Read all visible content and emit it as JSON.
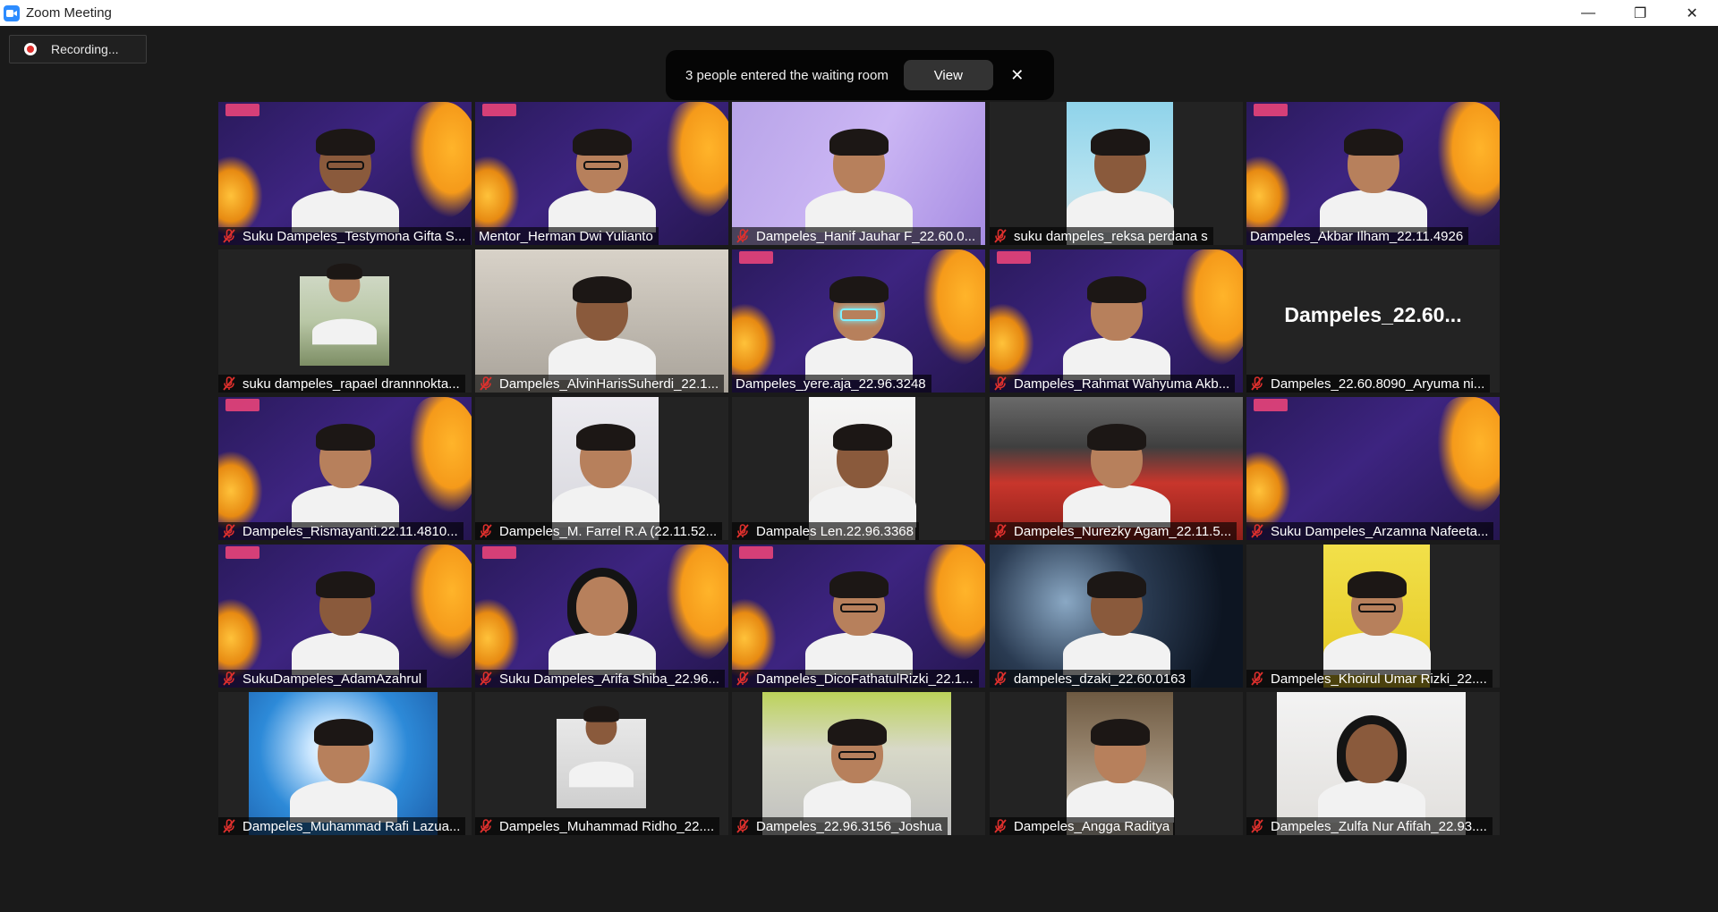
{
  "window": {
    "title": "Zoom Meeting",
    "minimize": "—",
    "restore": "❐",
    "close": "✕"
  },
  "recording": {
    "label": "Recording..."
  },
  "waiting_notice": {
    "message": "3 people entered the waiting room",
    "view_label": "View",
    "close": "✕"
  },
  "colors": {
    "active_speaker_border": "#e6e35a",
    "muted_mic": "#e0302d",
    "zoom_blue": "#2d8cff"
  },
  "participants": [
    {
      "name": "Suku Dampeles_Testymona Gifta S...",
      "muted": true,
      "active": false,
      "bg": "purple",
      "video": "full"
    },
    {
      "name": "Mentor_Herman Dwi Yulianto",
      "muted": false,
      "active": true,
      "bg": "purple",
      "video": "full"
    },
    {
      "name": "Dampeles_Hanif Jauhar F_22.60.0...",
      "muted": true,
      "active": false,
      "bg": "lilac",
      "video": "full"
    },
    {
      "name": "suku dampeles_reksa perdana s",
      "muted": true,
      "active": false,
      "bg": "sky",
      "video": "narrow"
    },
    {
      "name": "Dampeles_Akbar Ilham_22.11.4926",
      "muted": false,
      "active": false,
      "bg": "purple",
      "video": "full"
    },
    {
      "name": "suku dampeles_rapael drannnokta...",
      "muted": true,
      "active": false,
      "bg": "grass",
      "video": "small"
    },
    {
      "name": "Dampeles_AlvinHarisSuherdi_22.1...",
      "muted": true,
      "active": false,
      "bg": "room",
      "video": "full"
    },
    {
      "name": "Dampeles_yere.aja_22.96.3248",
      "muted": false,
      "active": false,
      "bg": "purple",
      "video": "full"
    },
    {
      "name": "Dampeles_Rahmat Wahyuma Akb...",
      "muted": true,
      "active": false,
      "bg": "purple",
      "video": "full"
    },
    {
      "name": "Dampeles_22.60.8090_Aryuma ni...",
      "muted": true,
      "active": false,
      "bg": "none",
      "video": "none",
      "display_name": "Dampeles_22.60..."
    },
    {
      "name": "Dampeles_Rismayanti.22.11.4810...",
      "muted": true,
      "active": false,
      "bg": "purple",
      "video": "full"
    },
    {
      "name": "Dampeles_M. Farrel R.A (22.11.52...",
      "muted": true,
      "active": false,
      "bg": "light",
      "video": "narrow"
    },
    {
      "name": "Dampales Len.22.96.3368",
      "muted": true,
      "active": false,
      "bg": "white",
      "video": "narrow"
    },
    {
      "name": "Dampeles_Nurezky Agam_22.11.5...",
      "muted": true,
      "active": false,
      "bg": "red",
      "video": "full"
    },
    {
      "name": "Suku Dampeles_Arzamna Nafeeta...",
      "muted": true,
      "active": false,
      "bg": "purple",
      "video": "full"
    },
    {
      "name": "SukuDampeles_AdamAzahrul",
      "muted": true,
      "active": false,
      "bg": "purple",
      "video": "full"
    },
    {
      "name": "Suku Dampeles_Arifa Shiba_22.96...",
      "muted": true,
      "active": false,
      "bg": "purple",
      "video": "full"
    },
    {
      "name": "Dampeles_DicoFathatulRizki_22.1...",
      "muted": true,
      "active": false,
      "bg": "purple",
      "video": "full"
    },
    {
      "name": "dampeles_dzaki_22.60.0163",
      "muted": true,
      "active": false,
      "bg": "dark-splash",
      "video": "full"
    },
    {
      "name": "Dampeles_Khoirul Umar Rizki_22....",
      "muted": true,
      "active": false,
      "bg": "yellow",
      "video": "narrow"
    },
    {
      "name": "Dampeles_Muhammad Rafi Lazua...",
      "muted": true,
      "active": false,
      "bg": "blue-room",
      "video": "wide"
    },
    {
      "name": "Dampeles_Muhammad Ridho_22....",
      "muted": true,
      "active": false,
      "bg": "sit",
      "video": "small"
    },
    {
      "name": "Dampeles_22.96.3156_Joshua",
      "muted": true,
      "active": false,
      "bg": "green-wall",
      "video": "wide"
    },
    {
      "name": "Dampeles_Angga Raditya",
      "muted": true,
      "active": false,
      "bg": "wood",
      "video": "narrow"
    },
    {
      "name": "Dampeles_Zulfa Nur Afifah_22.93....",
      "muted": true,
      "active": false,
      "bg": "hijab",
      "video": "wide"
    }
  ]
}
